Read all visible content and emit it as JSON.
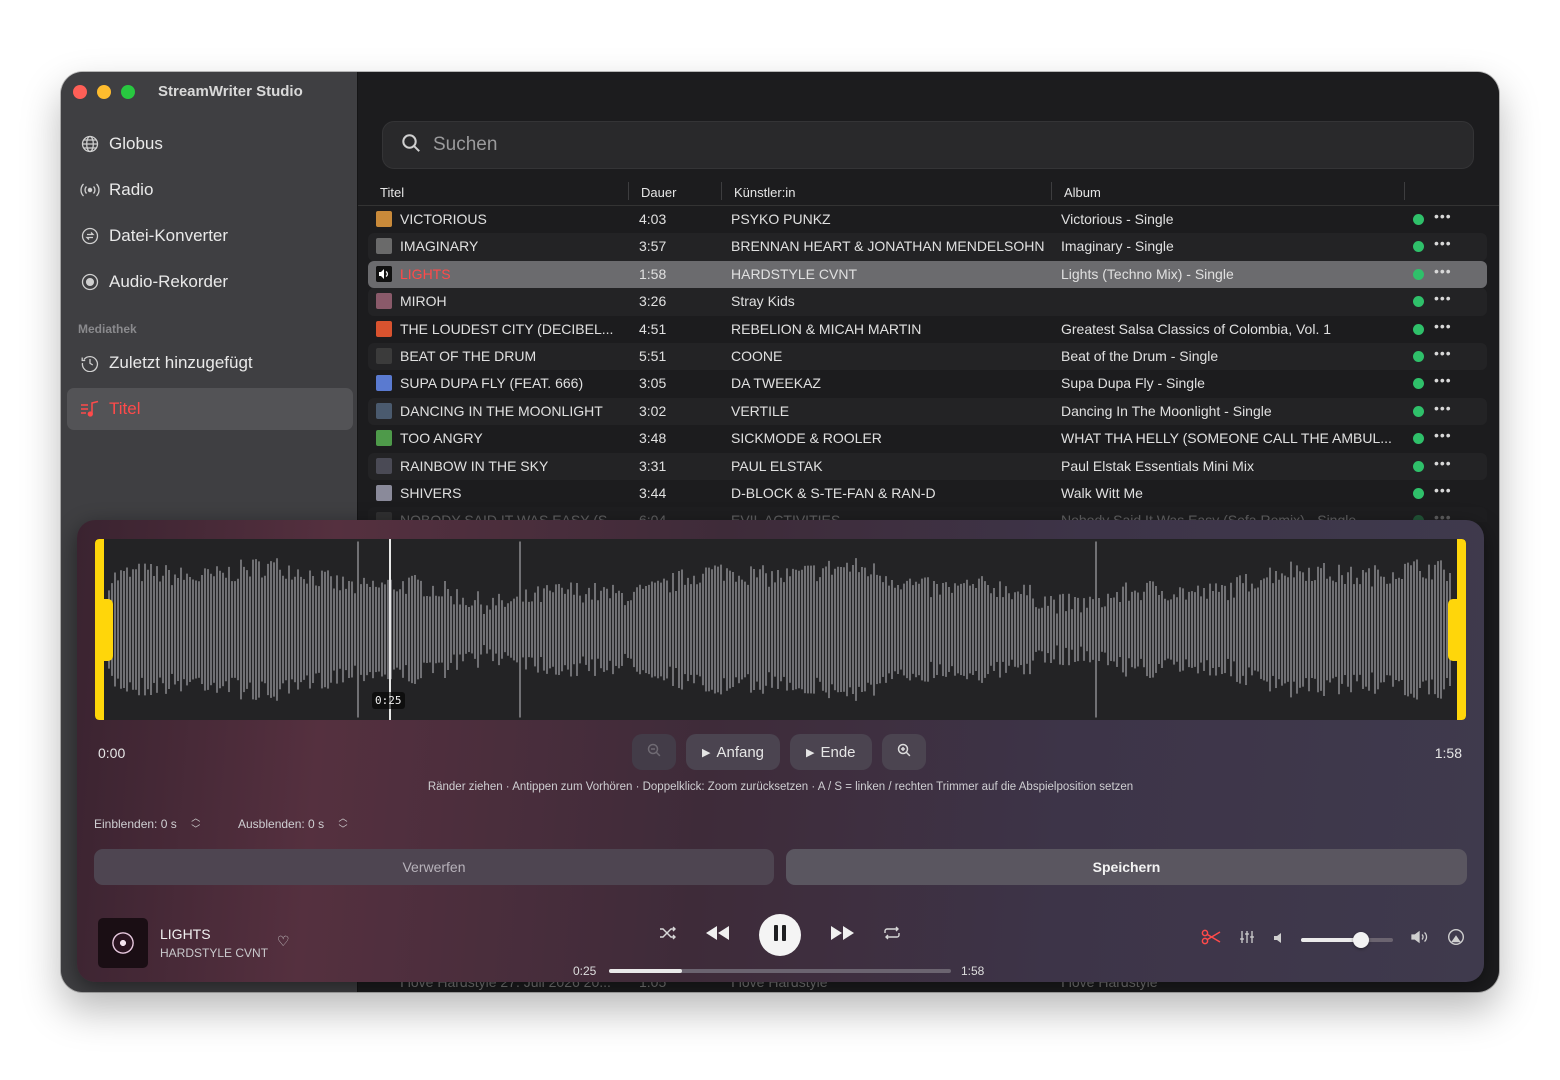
{
  "app": {
    "title": "StreamWriter Studio"
  },
  "sidebar": {
    "items": [
      {
        "label": "Globus",
        "icon": "globe-icon"
      },
      {
        "label": "Radio",
        "icon": "radio-waves-icon"
      },
      {
        "label": "Datei-Konverter",
        "icon": "convert-icon"
      },
      {
        "label": "Audio-Rekorder",
        "icon": "record-icon"
      }
    ],
    "section": "Mediathek",
    "library": [
      {
        "label": "Zuletzt hinzugefügt",
        "icon": "clock-icon"
      },
      {
        "label": "Titel",
        "icon": "music-list-icon",
        "active": true
      }
    ],
    "accent": "#ff4a4a"
  },
  "search": {
    "placeholder": "Suchen"
  },
  "table": {
    "headers": {
      "title": "Titel",
      "duration": "Dauer",
      "artist": "Künstler:in",
      "album": "Album"
    },
    "rows": [
      {
        "title": "VICTORIOUS",
        "duration": "4:03",
        "artist": "PSYKO PUNKZ",
        "album": "Victorious - Single",
        "art": "#c98a3a"
      },
      {
        "title": "IMAGINARY",
        "duration": "3:57",
        "artist": "BRENNAN HEART & JONATHAN MENDELSOHN",
        "album": "Imaginary - Single",
        "art": "#6a6a6a"
      },
      {
        "title": "LIGHTS",
        "duration": "1:58",
        "artist": "HARDSTYLE CVNT",
        "album": "Lights (Techno Mix) - Single",
        "art": "#222222",
        "playing": true
      },
      {
        "title": "MIROH",
        "duration": "3:26",
        "artist": "Stray Kids",
        "album": "",
        "art": "#8a5a6a"
      },
      {
        "title": "THE LOUDEST CITY (DECIBEL...",
        "duration": "4:51",
        "artist": "REBELION & MICAH MARTIN",
        "album": "Greatest Salsa Classics of Colombia, Vol. 1",
        "art": "#d9532f"
      },
      {
        "title": "BEAT OF THE DRUM",
        "duration": "5:51",
        "artist": "COONE",
        "album": "Beat of the Drum - Single",
        "art": "#3b3b3b"
      },
      {
        "title": "SUPA DUPA FLY (FEAT. 666)",
        "duration": "3:05",
        "artist": "DA TWEEKAZ",
        "album": "Supa Dupa Fly - Single",
        "art": "#5a7ad0"
      },
      {
        "title": "DANCING IN THE MOONLIGHT",
        "duration": "3:02",
        "artist": "VERTILE",
        "album": "Dancing In The Moonlight - Single",
        "art": "#4a5a6e"
      },
      {
        "title": "TOO ANGRY",
        "duration": "3:48",
        "artist": "SICKMODE & ROOLER",
        "album": "WHAT THA HELLY (SOMEONE CALL THE AMBUL...",
        "art": "#4e9a4a"
      },
      {
        "title": "RAINBOW IN THE SKY",
        "duration": "3:31",
        "artist": "PAUL ELSTAK",
        "album": "Paul Elstak Essentials Mini Mix",
        "art": "#4a4a55"
      },
      {
        "title": "SHIVERS",
        "duration": "3:44",
        "artist": "D-BLOCK & S-TE-FAN & RAN-D",
        "album": "Walk Witt Me",
        "art": "#8a8a9a"
      },
      {
        "title": "NOBODY SAID IT WAS EASY (S...",
        "duration": "6:04",
        "artist": "EVIL ACTIVITIES",
        "album": "Nobody Said It Was Easy (Sefa Remix) - Single",
        "art": "#555555"
      }
    ],
    "bottom_row": {
      "title": "I love Hardstyle 27. Juli 2026 20...",
      "duration": "1:05",
      "artist": "I love Hardstyle",
      "album": "I love Hardstyle"
    }
  },
  "editor": {
    "playhead_label": "0:25",
    "playhead_fraction": 0.212,
    "start_time": "0:00",
    "end_time": "1:58",
    "buttons": {
      "start": "Anfang",
      "end": "Ende"
    },
    "hint": "Ränder ziehen · Antippen zum Vorhören · Doppelklick: Zoom zurücksetzen · A / S = linken / rechten Trimmer auf die Abspielposition setzen",
    "fade_in": "Einblenden: 0 s",
    "fade_out": "Ausblenden: 0 s",
    "discard": "Verwerfen",
    "save": "Speichern",
    "trim_color": "#ffd60a"
  },
  "player": {
    "song": "LIGHTS",
    "artist": "HARDSTYLE CVNT",
    "elapsed": "0:25",
    "total": "1:58",
    "progress": 0.212,
    "volume": 0.65,
    "scissors_color": "#ff4a4a"
  }
}
